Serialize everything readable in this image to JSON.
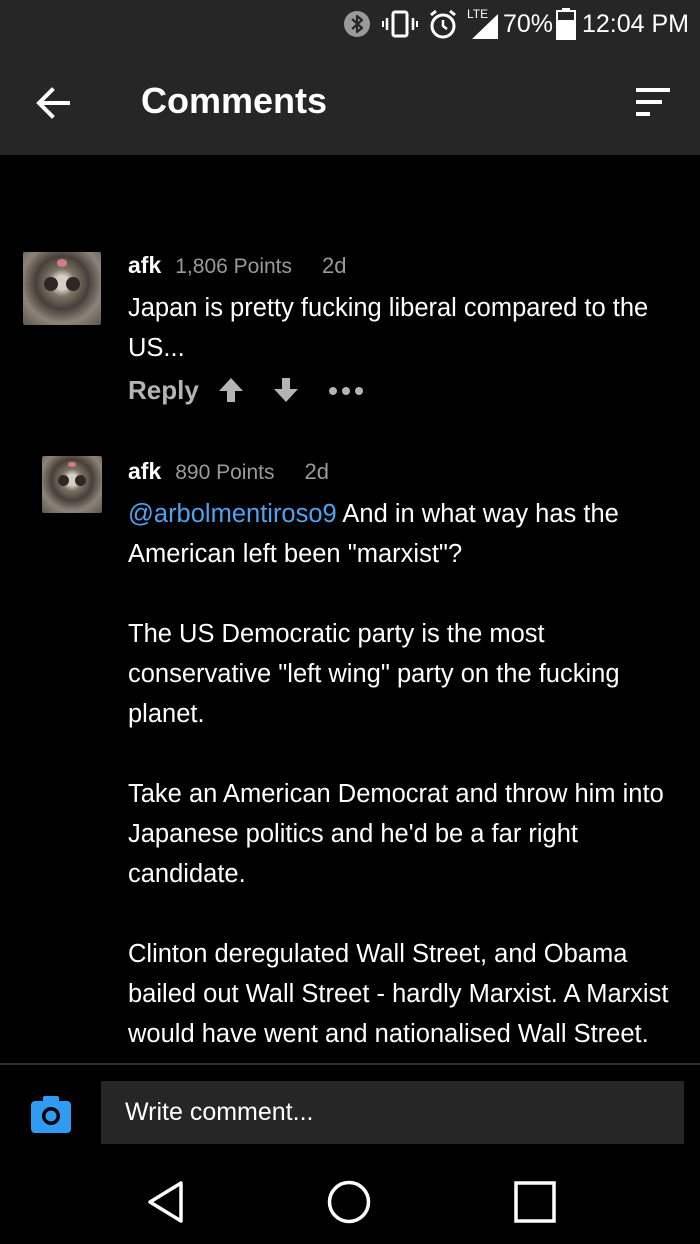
{
  "status_bar": {
    "battery_percent": "70%",
    "time": "12:04 PM",
    "network_label": "LTE",
    "icons": [
      "bluetooth-icon",
      "vibrate-icon",
      "alarm-icon",
      "signal-icon",
      "battery-icon"
    ],
    "battery_level": 0.7
  },
  "app_bar": {
    "title": "Comments",
    "back_icon": "arrow-left-icon",
    "sort_icon": "sort-icon"
  },
  "comments": [
    {
      "username": "afk",
      "points": "1,806 Points",
      "age": "2d",
      "text": "Japan is pretty fucking liberal compared to the US...",
      "reply_label": "Reply"
    },
    {
      "username": "afk",
      "points": "890 Points",
      "age": "2d",
      "mention": "@arbolmentiroso9",
      "paragraphs": [
        " And in what way has the American left been \"marxist\"?",
        "The US Democratic party is the most conservative \"left wing\" party on the fucking planet.",
        "Take an American Democrat and throw him into Japanese politics and he'd be a far right candidate.",
        "Clinton deregulated Wall Street, and Obama bailed out Wall Street - hardly Marxist. A Marxist would have went and nationalised Wall Street."
      ]
    }
  ],
  "composer": {
    "placeholder": "Write comment...",
    "camera_icon": "camera-icon"
  },
  "nav_bar": {
    "icons": [
      "back-triangle-icon",
      "home-circle-icon",
      "recents-square-icon"
    ]
  },
  "colors": {
    "background": "#000000",
    "bar": "#262626",
    "mention": "#4ea3f0",
    "muted": "#9a9a9a",
    "accent": "#2f9bf3"
  }
}
